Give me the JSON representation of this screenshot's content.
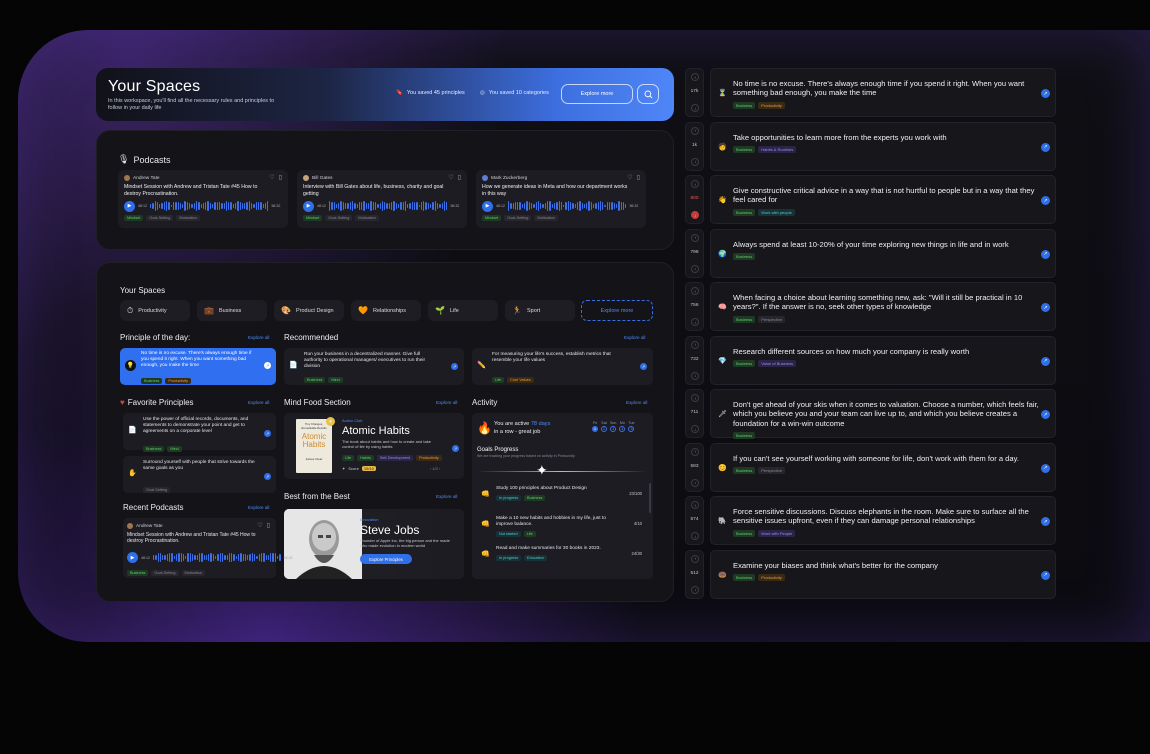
{
  "header": {
    "title": "Your Spaces",
    "subtitle": "In this workspace, you'll find all the necessary rules and principles to follow in your daily life",
    "saved_principles": "You saved 45 principles",
    "saved_categories": "You saved 10 categories",
    "explore_button": "Explore more"
  },
  "podcasts": {
    "title": "Podcasts",
    "items": [
      {
        "author": "Andrew Tate",
        "title": "Mindset Session with Andrew and Tristan Tate #45 How to destroy Procrastination.",
        "start": "48:12",
        "end": "56:32",
        "tags": [
          "Mindset",
          "Goal-Setting",
          "Motivation"
        ]
      },
      {
        "author": "Bill Gates",
        "title": "Interview with Bill Gates about life, business, charity and goal getting",
        "start": "48:12",
        "end": "56:32",
        "tags": [
          "Mindset",
          "Goal-Setting",
          "Motivation"
        ]
      },
      {
        "author": "Mark Zuckerberg",
        "title": "How we generate ideas in Meta and how our department works in this way",
        "start": "48:12",
        "end": "56:32",
        "tags": [
          "Mindset",
          "Goal-Setting",
          "Motivation"
        ]
      }
    ]
  },
  "spaces": {
    "title": "Your Spaces",
    "categories": [
      {
        "icon": "clock-icon",
        "emoji": "⏱",
        "label": "Productivity"
      },
      {
        "icon": "briefcase-icon",
        "emoji": "💼",
        "label": "Business"
      },
      {
        "icon": "palette-icon",
        "emoji": "🎨",
        "label": "Product Design"
      },
      {
        "icon": "heart-icon",
        "emoji": "🧡",
        "label": "Relationships"
      },
      {
        "icon": "leaf-icon",
        "emoji": "🌱",
        "label": "Life"
      },
      {
        "icon": "runner-icon",
        "emoji": "🏃",
        "label": "Sport"
      }
    ],
    "explore": "Explore more"
  },
  "principle_day": {
    "title": "Principle of the day:",
    "explore": "Explore all",
    "text": "No time is no excuse. There's always enough time if you spend it right. When you want something bad enough, you make the time",
    "tags": [
      "Business",
      "Productivity"
    ]
  },
  "recommended": {
    "title": "Recommended",
    "explore": "Explore all",
    "items": [
      {
        "text": "Run your business in a decentralized manner. Give full authority to operational managers/ executives to run their division",
        "tags": [
          "Business",
          "Mind"
        ]
      },
      {
        "text": "For measuring your life's success, establish metrics that resemble your life values",
        "tags": [
          "Life",
          "Core Values"
        ]
      }
    ]
  },
  "favorite": {
    "title": "Favorite Principles",
    "explore": "Explore all",
    "items": [
      {
        "text": "Use the power of official records, documents, and statements to demonstrate your point and get to agreements on a corporate level",
        "tags": [
          "Business",
          "Mind"
        ]
      },
      {
        "text": "Surround yourself with people that strive towards the same goals as you",
        "tags": [
          "Goal-Setting"
        ]
      }
    ]
  },
  "mindfood": {
    "title": "Mind Food Section",
    "explore": "Explore all",
    "kind": "Action Club",
    "book": "Atomic Habits",
    "cover_top": "Tiny Changes, Remarkable Results",
    "cover_title": "Atomic Habits",
    "author": "James Clear",
    "desc": "The book about habits and how to create and take control of life by using habits",
    "tags": [
      "Life",
      "Habits",
      "Self-Development",
      "Productivity"
    ],
    "score_label": "Score",
    "score": "10/10",
    "pages": "1/3"
  },
  "activity": {
    "title": "Activity",
    "explore": "Explore all",
    "active_prefix": "You are active ",
    "active_days": "78 days",
    "active_suffix": "in a row - great job",
    "days": [
      {
        "label": "Fri",
        "num": "1"
      },
      {
        "label": "Sat",
        "num": "2"
      },
      {
        "label": "Sun",
        "num": "3"
      },
      {
        "label": "Mo",
        "num": "4"
      },
      {
        "label": "Tue",
        "num": "5"
      }
    ],
    "goals_title": "Goals Progress",
    "goals_sub": "We are tracking your progress based on activity in Profoundly",
    "goals": [
      {
        "icon": "👊",
        "text": "Study 100 principles about Product Design",
        "count": "23/100",
        "tags": [
          "In progress",
          "Business"
        ]
      },
      {
        "icon": "👊",
        "text": "Make a 10 new habits and hobbies in my life, just to improve balance.",
        "count": "4/10",
        "tags": [
          "Not started",
          "Life"
        ]
      },
      {
        "icon": "👊",
        "text": "Read and make summaries for 30 books in 2023.",
        "count": "24/30",
        "tags": [
          "In progress",
          "Education"
        ]
      }
    ]
  },
  "best": {
    "title": "Best from the Best",
    "explore": "Explore all",
    "kind": "Innovation",
    "name": "Steve Jobs",
    "desc": "Founder of Apple inc, the big person and the made who made evolution in modern world",
    "button": "Explore Principles"
  },
  "recent": {
    "title": "Recent Podcasts",
    "explore": "Explore all",
    "author": "Andrew Tate",
    "text": "Mindset Session with Andrew and Tristan Tate #45 How to destroy Procrastination.",
    "start": "48:12",
    "end": "56:32",
    "tags": [
      "Business",
      "Goal-Setting",
      "Motivation"
    ]
  },
  "feed": [
    {
      "count": "17k",
      "icon": "⏳",
      "text": "No time is no excuse. There's always enough time if you spend it right. When you want something bad enough, you make the time",
      "tags": [
        "Business",
        "Productivity"
      ]
    },
    {
      "count": "1k",
      "icon": "🧑",
      "text": "Take opportunities to learn more from the experts you work with",
      "tags": [
        "Business",
        "Habits & Routines"
      ]
    },
    {
      "count": "800",
      "icon": "👋",
      "text": "Give constructive critical advice in a way that is not hurtful to people but in a way that they feel cared for",
      "tags": [
        "Business",
        "Work with people"
      ]
    },
    {
      "count": "798",
      "icon": "🌍",
      "text": "Always spend at least 10-20% of your time exploring new things in life and in work",
      "tags": [
        "Business"
      ]
    },
    {
      "count": "756",
      "icon": "🧠",
      "text": "When facing a choice about learning something new, ask: \"Will it still be practical in 10 years?\". If the answer is no, seek other types of knowledge",
      "tags": [
        "Business",
        "Perspective"
      ]
    },
    {
      "count": "732",
      "icon": "💎",
      "text": "Research different sources on how much your company is really worth",
      "tags": [
        "Business",
        "Value of Business"
      ]
    },
    {
      "count": "711",
      "icon": "🗡",
      "text": "Don't get ahead of your skis when it comes to valuation. Choose a number, which feels fair, which you believe you and your team can live up to, and which you believe creates a foundation for a win-win outcome",
      "tags": [
        "Business"
      ]
    },
    {
      "count": "583",
      "icon": "😊",
      "text": "If you can't see yourself working with someone for life, don't work with them for a day.",
      "tags": [
        "Business",
        "Perspective"
      ]
    },
    {
      "count": "574",
      "icon": "🐘",
      "text": "Force sensitive discussions. Discuss elephants in the room. Make sure to surface all the sensitive issues upfront, even if they can damage personal relationships",
      "tags": [
        "Business",
        "Work with People"
      ]
    },
    {
      "count": "512",
      "icon": "🍩",
      "text": "Examine your biases and think what's better for the company",
      "tags": [
        "Business",
        "Productivity"
      ]
    }
  ]
}
